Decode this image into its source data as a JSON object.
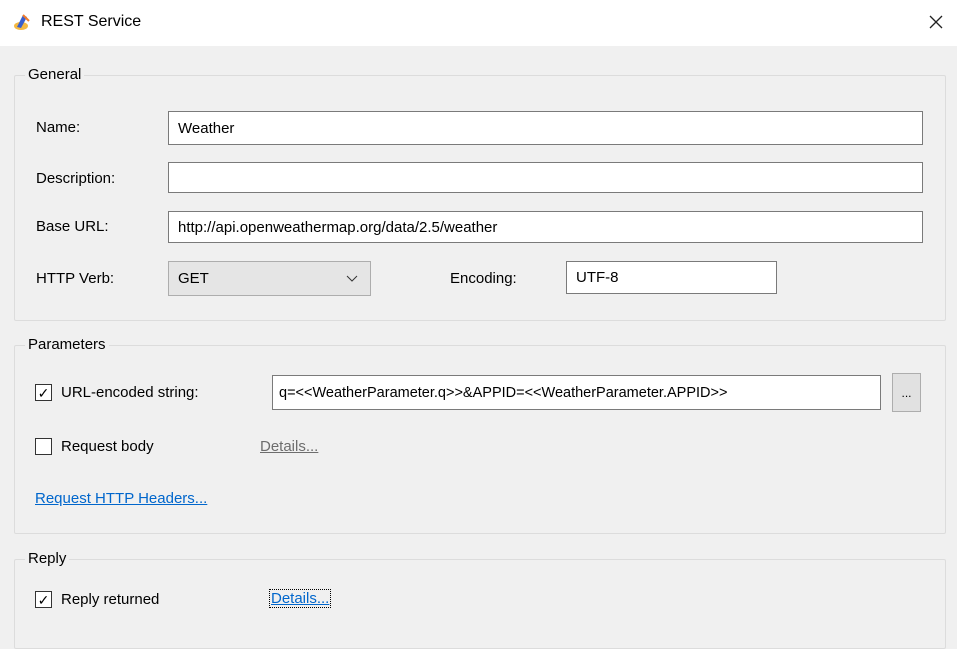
{
  "window": {
    "title": "REST Service",
    "close_icon": "close-icon",
    "app_icon": "rest-service-icon"
  },
  "general": {
    "legend": "General",
    "name_label": "Name:",
    "name_value": "Weather",
    "description_label": "Description:",
    "description_value": "",
    "base_url_label": "Base URL:",
    "base_url_value": "http://api.openweathermap.org/data/2.5/weather",
    "http_verb_label": "HTTP Verb:",
    "http_verb_value": "GET",
    "encoding_label": "Encoding:",
    "encoding_value": "UTF-8"
  },
  "parameters": {
    "legend": "Parameters",
    "url_encoded_label": "URL-encoded string:",
    "url_encoded_checked": true,
    "url_encoded_value": "q=<<WeatherParameter.q>>&APPID=<<WeatherParameter.APPID>>",
    "browse_label": "...",
    "request_body_label": "Request body",
    "request_body_checked": false,
    "request_body_details": "Details...",
    "headers_link": "Request HTTP Headers..."
  },
  "reply": {
    "legend": "Reply",
    "reply_returned_label": "Reply returned",
    "reply_returned_checked": true,
    "details": "Details..."
  }
}
